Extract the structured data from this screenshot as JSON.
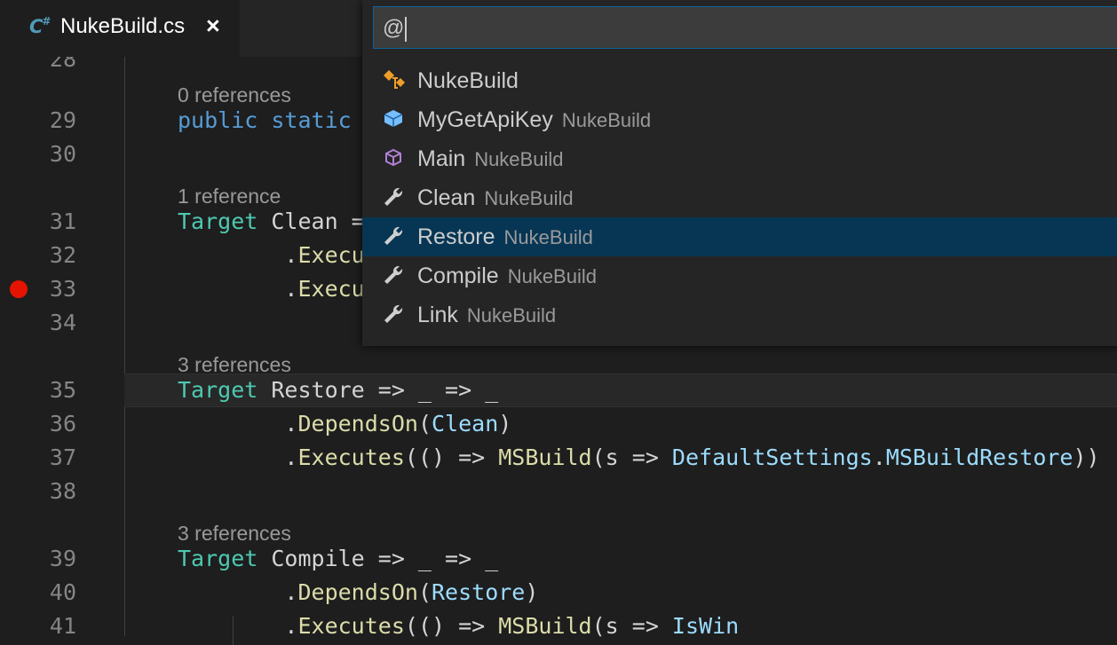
{
  "tab": {
    "icon_text": "C",
    "icon_sub": "#",
    "label": "NukeBuild.cs",
    "close": "×"
  },
  "colors": {
    "accent": "#0e639c",
    "selected_item": "#073655",
    "breakpoint": "#e51400",
    "type": "#4ec9b0",
    "keyword": "#569cd6",
    "method": "#dcdcaa",
    "identifier": "#9cdcfe"
  },
  "picker": {
    "query": "@",
    "items": [
      {
        "icon": "class-icon",
        "label": "NukeBuild",
        "desc": ""
      },
      {
        "icon": "field-icon",
        "label": "MyGetApiKey",
        "desc": "NukeBuild"
      },
      {
        "icon": "method-icon",
        "label": "Main",
        "desc": "NukeBuild"
      },
      {
        "icon": "property-icon",
        "label": "Clean",
        "desc": "NukeBuild"
      },
      {
        "icon": "property-icon",
        "label": "Restore",
        "desc": "NukeBuild",
        "selected": true
      },
      {
        "icon": "property-icon",
        "label": "Compile",
        "desc": "NukeBuild"
      },
      {
        "icon": "property-icon",
        "label": "Link",
        "desc": "NukeBuild"
      }
    ]
  },
  "editor": {
    "partial_line_number": "28",
    "lenses": [
      "0 references",
      "1 reference",
      "3 references",
      "3 references"
    ],
    "lines": [
      {
        "num": "29",
        "tokens": [
          [
            "public",
            "k-kw"
          ],
          [
            " ",
            "k-plain"
          ],
          [
            "static",
            "k-kw"
          ]
        ]
      },
      {
        "num": "30",
        "tokens": []
      },
      {
        "num": "31",
        "tokens": [
          [
            "Target",
            "k-type"
          ],
          [
            " Clean =",
            "k-plain"
          ]
        ]
      },
      {
        "num": "32",
        "tokens": [
          [
            "        .",
            "k-plain"
          ],
          [
            "Execu",
            "k-fn"
          ]
        ]
      },
      {
        "num": "33",
        "breakpoint": true,
        "tokens": [
          [
            "        .",
            "k-plain"
          ],
          [
            "Execu",
            "k-fn"
          ]
        ]
      },
      {
        "num": "34",
        "tokens": []
      },
      {
        "num": "35",
        "current": true,
        "tokens": [
          [
            "Target",
            "k-type"
          ],
          [
            " Restore => _ => _",
            "k-plain"
          ]
        ]
      },
      {
        "num": "36",
        "tokens": [
          [
            "        .",
            "k-plain"
          ],
          [
            "DependsOn",
            "k-fn"
          ],
          [
            "(",
            "k-plain"
          ],
          [
            "Clean",
            "k-id"
          ],
          [
            ")",
            "k-plain"
          ]
        ]
      },
      {
        "num": "37",
        "tokens": [
          [
            "        .",
            "k-plain"
          ],
          [
            "Executes",
            "k-fn"
          ],
          [
            "(() => ",
            "k-plain"
          ],
          [
            "MSBuild",
            "k-fn"
          ],
          [
            "(s => ",
            "k-plain"
          ],
          [
            "DefaultSettings",
            "k-id"
          ],
          [
            ".",
            "k-plain"
          ],
          [
            "MSBuildRestore",
            "k-id"
          ],
          [
            "))",
            "k-plain"
          ]
        ]
      },
      {
        "num": "38",
        "tokens": []
      },
      {
        "num": "39",
        "tokens": [
          [
            "Target",
            "k-type"
          ],
          [
            " Compile => _ => _",
            "k-plain"
          ]
        ]
      },
      {
        "num": "40",
        "tokens": [
          [
            "        .",
            "k-plain"
          ],
          [
            "DependsOn",
            "k-fn"
          ],
          [
            "(",
            "k-plain"
          ],
          [
            "Restore",
            "k-id"
          ],
          [
            ")",
            "k-plain"
          ]
        ]
      },
      {
        "num": "41",
        "tokens": [
          [
            "        .",
            "k-plain"
          ],
          [
            "Executes",
            "k-fn"
          ],
          [
            "(() => ",
            "k-plain"
          ],
          [
            "MSBuild",
            "k-fn"
          ],
          [
            "(s => ",
            "k-plain"
          ],
          [
            "IsWin",
            "k-id"
          ]
        ]
      }
    ]
  }
}
